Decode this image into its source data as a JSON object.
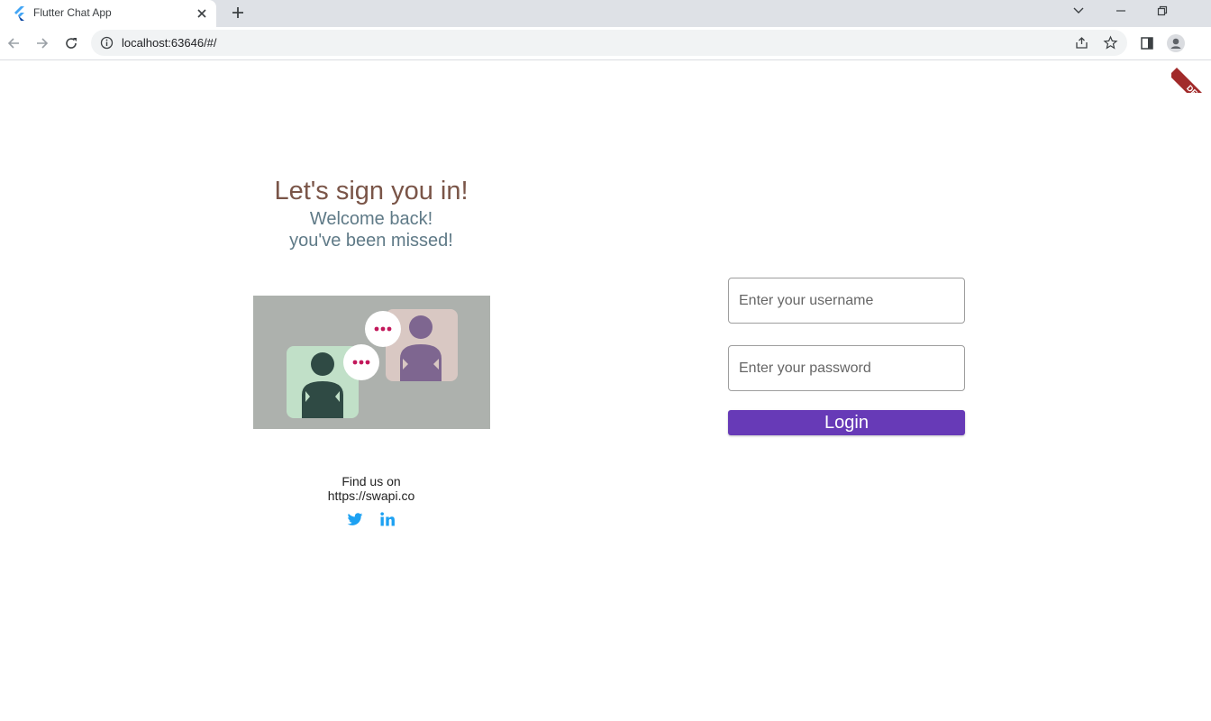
{
  "browser": {
    "tab_title": "Flutter Chat App",
    "url": "localhost:63646/#/"
  },
  "debug_banner": "DEBUG",
  "signin": {
    "title": "Let's sign you in!",
    "subtitle_line1": "Welcome back!",
    "subtitle_line2": "you've been missed!"
  },
  "footer": {
    "find_us": "Find us on",
    "link": "https://swapi.co"
  },
  "form": {
    "username_placeholder": "Enter your username",
    "password_placeholder": "Enter your password",
    "login_label": "Login"
  },
  "colors": {
    "title": "#7a5548",
    "subtitle": "#5f7a87",
    "login_button": "#673ab7",
    "social_icons": "#1da1f2"
  },
  "icons": [
    "flutter-icon",
    "close-icon",
    "plus-icon",
    "back-icon",
    "forward-icon",
    "reload-icon",
    "info-icon",
    "share-icon",
    "star-icon",
    "sidepanel-icon",
    "profile-icon",
    "twitter-icon",
    "linkedin-icon"
  ]
}
